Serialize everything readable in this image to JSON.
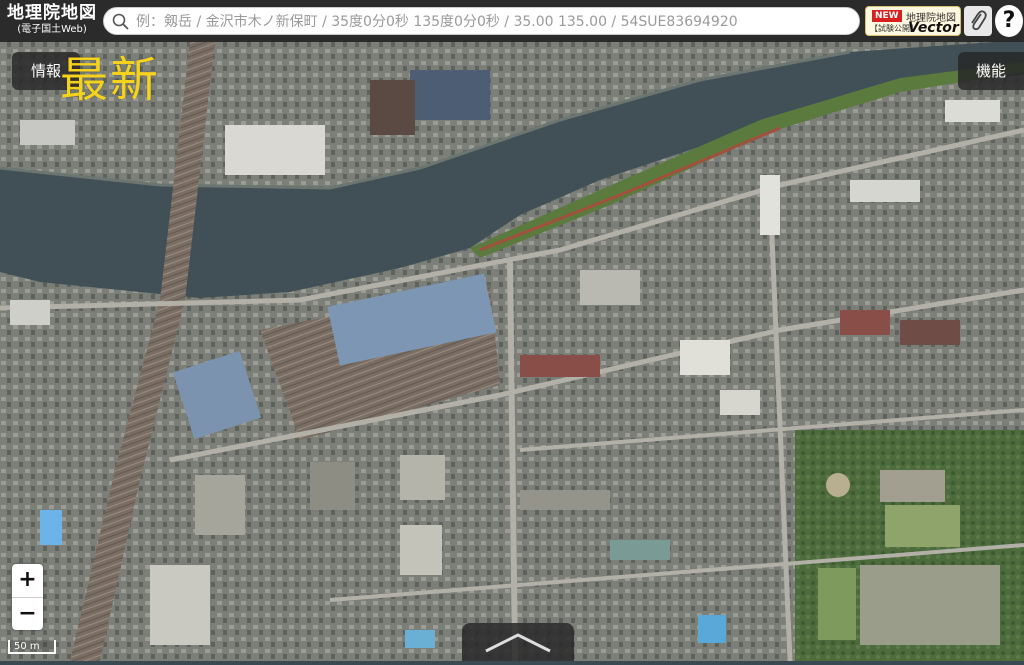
{
  "header": {
    "logo_title": "地理院地図",
    "logo_subtitle": "(電子国土Web)",
    "search_placeholder": "例：剱岳 / 金沢市木ノ新保町 / 35度0分0秒 135度0分0秒 / 35.00 135.00 / 54SUE83694920",
    "vector_badge": "NEW",
    "vector_title": "地理院地図",
    "vector_trial": "【試験公開】",
    "vector_label": "Vector",
    "help_label": "?"
  },
  "map": {
    "info_button": "情報",
    "functions_button": "機能",
    "overlay_text": "最新",
    "zoom_in": "+",
    "zoom_out": "−",
    "scale_label": "50 m"
  },
  "colors": {
    "toolbar": "#2b2b2b",
    "overlay_text": "#f5d21c",
    "water": "#415056",
    "badge": "#d8211f"
  },
  "icons": [
    "search-icon",
    "paperclip-icon",
    "help-icon",
    "chevron-up-icon"
  ]
}
